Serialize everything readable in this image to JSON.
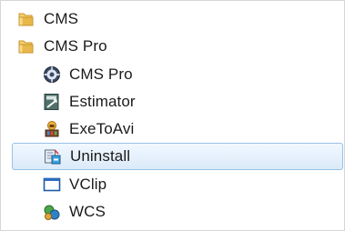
{
  "start_menu": {
    "items": [
      {
        "label": "CMS",
        "icon": "folder-icon",
        "level": 0
      },
      {
        "label": "CMS Pro",
        "icon": "folder-icon",
        "level": 0
      },
      {
        "label": "CMS Pro",
        "icon": "cms-pro-app-icon",
        "level": 1
      },
      {
        "label": "Estimator",
        "icon": "estimator-app-icon",
        "level": 1
      },
      {
        "label": "ExeToAvi",
        "icon": "exetoavi-app-icon",
        "level": 1
      },
      {
        "label": "Uninstall",
        "icon": "uninstall-app-icon",
        "level": 1,
        "selected": true
      },
      {
        "label": "VClip",
        "icon": "vclip-app-icon",
        "level": 1
      },
      {
        "label": "WCS",
        "icon": "wcs-app-icon",
        "level": 1
      }
    ]
  },
  "colors": {
    "selection_fill_top": "#f1f8ff",
    "selection_fill_bottom": "#dbeaf9",
    "selection_border": "#99c0e8",
    "folder_yellow": "#e8b84a"
  }
}
